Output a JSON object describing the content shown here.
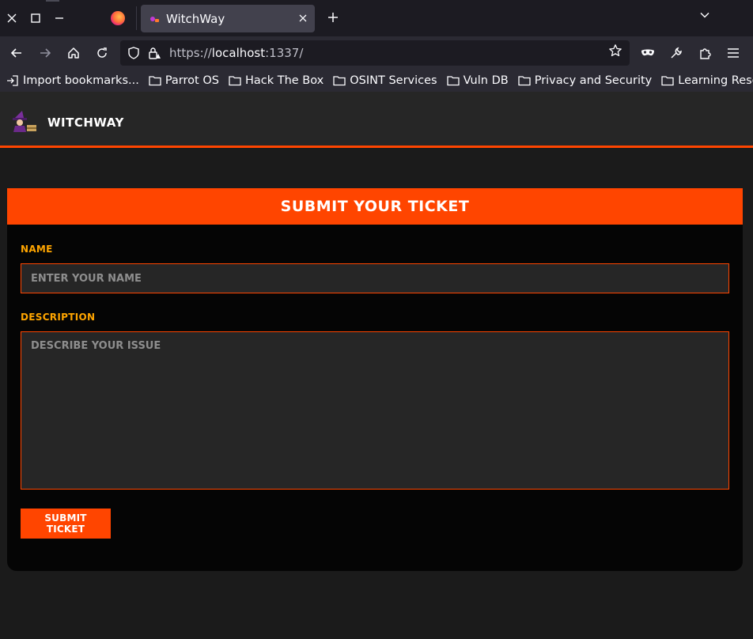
{
  "browser": {
    "tab_title": "WitchWay",
    "url_scheme": "https://",
    "url_host": "localhost",
    "url_rest": ":1337/",
    "bookmarks": [
      {
        "label": "Import bookmarks...",
        "icon": "import-icon"
      },
      {
        "label": "Parrot OS",
        "icon": "folder-icon"
      },
      {
        "label": "Hack The Box",
        "icon": "folder-icon"
      },
      {
        "label": "OSINT Services",
        "icon": "folder-icon"
      },
      {
        "label": "Vuln DB",
        "icon": "folder-icon"
      },
      {
        "label": "Privacy and Security",
        "icon": "folder-icon"
      },
      {
        "label": "Learning Resources",
        "icon": "folder-icon"
      }
    ]
  },
  "site": {
    "name": "WitchWay",
    "accent_color": "#ff4500",
    "label_color": "#ffa500"
  },
  "form": {
    "title": "Submit Your Ticket",
    "name_label": "Name",
    "name_placeholder": "Enter your name",
    "name_value": "",
    "description_label": "Description",
    "description_placeholder": "Describe your issue",
    "description_value": "",
    "submit_label": "Submit Ticket"
  }
}
